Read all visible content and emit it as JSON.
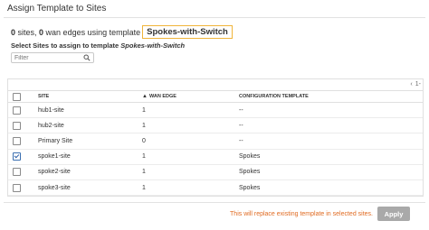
{
  "dialog": {
    "title": "Assign Template to Sites"
  },
  "summary": {
    "sites_count": "0",
    "sites_text": " sites, ",
    "edges_count": "0",
    "edges_text": " wan edges using template",
    "template_name": "Spokes-with-Switch"
  },
  "select_label": {
    "prefix": "Select Sites to assign to template ",
    "template": "Spokes-with-Switch"
  },
  "filter": {
    "placeholder": "Filter"
  },
  "pager": {
    "text": "1-"
  },
  "table": {
    "columns": [
      "SITE",
      "WAN EDGE",
      "CONFIGURATION TEMPLATE"
    ],
    "sorted_column": "WAN EDGE",
    "rows": [
      {
        "site": "hub1-site",
        "wan_edge": "1",
        "template": "--",
        "checked": false
      },
      {
        "site": "hub2-site",
        "wan_edge": "1",
        "template": "--",
        "checked": false
      },
      {
        "site": "Primary Site",
        "wan_edge": "0",
        "template": "--",
        "checked": false
      },
      {
        "site": "spoke1-site",
        "wan_edge": "1",
        "template": "Spokes",
        "checked": true
      },
      {
        "site": "spoke2-site",
        "wan_edge": "1",
        "template": "Spokes",
        "checked": false
      },
      {
        "site": "spoke3-site",
        "wan_edge": "1",
        "template": "Spokes",
        "checked": false
      }
    ]
  },
  "footer": {
    "warning": "This will replace existing template in selected sites.",
    "apply_label": "Apply"
  },
  "colors": {
    "accent_border": "#f0b43a",
    "warning_text": "#e06b22",
    "apply_disabled": "#a9a9a9",
    "checkbox_checked": "#2a5fa8"
  }
}
